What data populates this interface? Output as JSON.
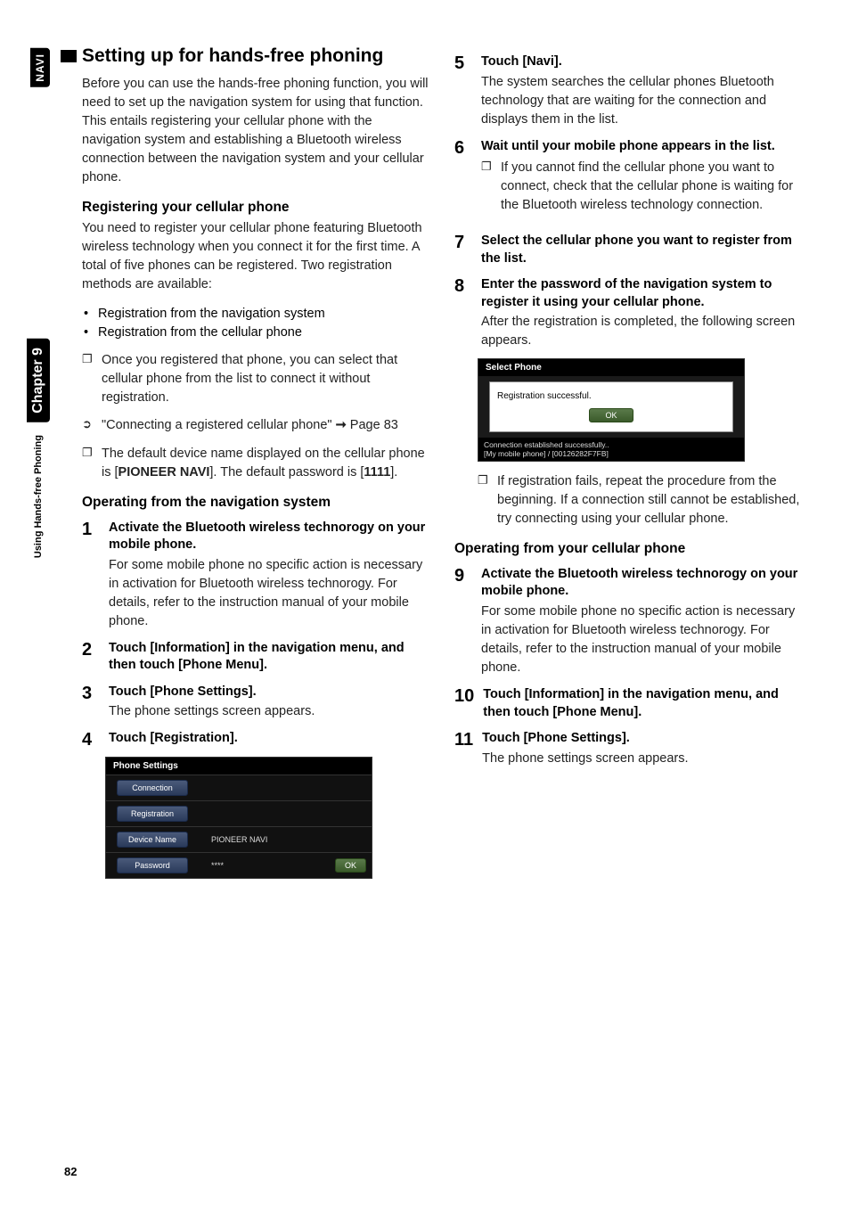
{
  "sideTabs": {
    "navi": "NAVI",
    "chapter": "Chapter 9",
    "section": "Using Hands-free Phoning"
  },
  "pageNumber": "82",
  "left": {
    "title": "Setting up for hands-free phoning",
    "intro": "Before you can use the hands-free phoning function, you will need to set up the navigation system for using that function. This entails registering your cellular phone with the navigation system and establishing a Bluetooth wireless connection between the navigation system and your cellular phone.",
    "sub1": "Registering your cellular phone",
    "sub1Body": "You need to register your cellular phone featuring Bluetooth wireless technology when you connect it for the first time. A total of five phones can be registered. Two registration methods are available:",
    "bullets": [
      "Registration from the navigation system",
      "Registration from the cellular phone"
    ],
    "note1": "Once you registered that phone, you can select that cellular phone from the list to connect it without registration.",
    "xrefPre": "\"Connecting a registered cellular phone\"",
    "xrefArrow": "➞",
    "xrefPost": "Page 83",
    "note2a": "The default device name displayed on the cellular phone is [",
    "note2b": "PIONEER NAVI",
    "note2c": "]. The default password is [",
    "note2d": "1111",
    "note2e": "].",
    "sub2": "Operating from the navigation system",
    "steps": {
      "s1": {
        "n": "1",
        "title": "Activate the Bluetooth wireless technorogy on your mobile phone.",
        "text": "For some mobile phone no specific action is necessary in activation for Bluetooth wireless technorogy. For details, refer to the instruction manual of your mobile phone."
      },
      "s2": {
        "n": "2",
        "title": "Touch [Information] in the navigation menu, and then touch [Phone Menu]."
      },
      "s3": {
        "n": "3",
        "title": "Touch [Phone Settings].",
        "text": "The phone settings screen appears."
      },
      "s4": {
        "n": "4",
        "title": "Touch [Registration]."
      }
    },
    "screenshot": {
      "header": "Phone Settings",
      "rows": {
        "connection": "Connection",
        "registration": "Registration",
        "deviceName": "Device Name",
        "deviceNameVal": "PIONEER NAVI",
        "password": "Password",
        "passwordVal": "****",
        "ok": "OK"
      }
    }
  },
  "right": {
    "steps": {
      "s5": {
        "n": "5",
        "title": "Touch [Navi].",
        "text": "The system searches the cellular phones Bluetooth technology that are waiting for the connection and displays them in the list."
      },
      "s6": {
        "n": "6",
        "title": "Wait until your mobile phone appears in the list.",
        "note": "If you cannot find the cellular phone you want to connect, check that the cellular phone is waiting for the Bluetooth wireless technology connection."
      },
      "s7": {
        "n": "7",
        "title": "Select the cellular phone you want to register from the list."
      },
      "s8": {
        "n": "8",
        "title": "Enter the password of the navigation system to register it using your cellular phone.",
        "text": "After the registration is completed, the following screen appears."
      },
      "s8note": "If registration fails, repeat the procedure from the beginning. If a connection still cannot be established, try connecting using your cellular phone."
    },
    "screenshot": {
      "header": "Select Phone",
      "dialogText": "Registration successful.",
      "ok": "OK",
      "footer1": "Connection established successfully..",
      "footer2": "[My mobile phone] / [00126282F7FB]"
    },
    "sub3": "Operating from your cellular phone",
    "steps2": {
      "s9": {
        "n": "9",
        "title": "Activate the Bluetooth wireless technorogy on your mobile phone.",
        "text": "For some mobile phone no specific action is necessary in activation for Bluetooth wireless technorogy. For details, refer to the instruction manual of your mobile phone."
      },
      "s10": {
        "n": "10",
        "title": "Touch [Information] in the navigation menu, and then touch [Phone Menu]."
      },
      "s11": {
        "n": "11",
        "title": "Touch [Phone Settings].",
        "text": "The phone settings screen appears."
      }
    }
  }
}
